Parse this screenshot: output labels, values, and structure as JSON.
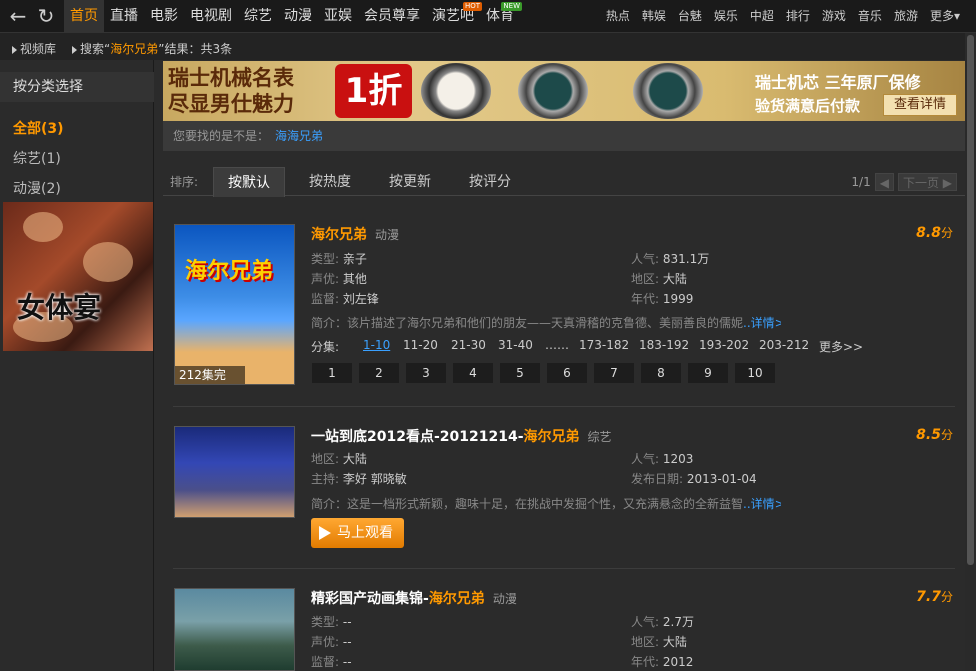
{
  "topbar": {
    "back_icon": "back-arrow-icon",
    "refresh_icon": "refresh-icon",
    "nav": [
      {
        "label": "首页"
      },
      {
        "label": "直播"
      },
      {
        "label": "电影"
      },
      {
        "label": "电视剧"
      },
      {
        "label": "综艺"
      },
      {
        "label": "动漫"
      },
      {
        "label": "亚娱"
      },
      {
        "label": "会员尊享"
      },
      {
        "label": "演艺吧",
        "badge": "HOT"
      },
      {
        "label": "体育",
        "badge": "NEW"
      }
    ],
    "right": [
      "热点",
      "韩娱",
      "台魅",
      "娱乐",
      "中超",
      "排行",
      "游戏",
      "音乐",
      "旅游",
      "更多"
    ]
  },
  "breadcrumb": {
    "lib": "视频库",
    "search_pre": "搜索“",
    "keyword": "海尔兄弟",
    "search_post": "”结果：共3条"
  },
  "sidebar": {
    "title": "按分类选择",
    "filters": [
      "全部(3)",
      "综艺(1)",
      "动漫(2)"
    ],
    "ad_text": "女体宴"
  },
  "banner": {
    "line1": "瑞士机械名表",
    "line2": "尽显男仕魅力",
    "discount": "1折",
    "slogan1": "瑞士机芯 三年原厂保修",
    "slogan2": "验货满意后付款",
    "button": "查看详情"
  },
  "suggest": {
    "label": "您要找的是不是：",
    "link": "海海兄弟"
  },
  "sort": {
    "label": "排序:",
    "tabs": [
      "按默认",
      "按热度",
      "按更新",
      "按评分"
    ],
    "page": "1/1",
    "next": "下一页"
  },
  "results": [
    {
      "title_hl": "海尔兄弟",
      "title_pre": "",
      "title_post": "",
      "cat": "动漫",
      "score_int": "8.8",
      "score_unit": "分",
      "fields": [
        [
          "类型:",
          "亲子"
        ],
        [
          "人气:",
          "831.1万"
        ],
        [
          "声优:",
          "其他"
        ],
        [
          "地区:",
          "大陆"
        ],
        [
          "监督:",
          "刘左锋"
        ],
        [
          "年代:",
          "1999"
        ]
      ],
      "desc_label": "简介：",
      "desc": "该片描述了海尔兄弟和他们的朋友——天真滑稽的克鲁德、美丽善良的儒妮",
      "more": "..详情>>",
      "eps_label": "分集:",
      "ep_ranges": [
        "1-10",
        "11-20",
        "21-30",
        "31-40",
        "……",
        "173-182",
        "183-192",
        "193-202",
        "203-212",
        "更多>>"
      ],
      "ep_buttons": [
        "1",
        "2",
        "3",
        "4",
        "5",
        "6",
        "7",
        "8",
        "9",
        "10"
      ],
      "poster_text": "海尔兄弟",
      "poster_eps": "212集完"
    },
    {
      "title_pre": "一站到底2012看点-20121214-",
      "title_hl": "海尔兄弟",
      "title_post": "",
      "cat": "综艺",
      "score_int": "8.5",
      "score_unit": "分",
      "fields": [
        [
          "地区:",
          "大陆"
        ],
        [
          "人气:",
          "1203"
        ],
        [
          "主持:",
          "李好  郭晓敏"
        ],
        [
          "发布日期:",
          "2013-01-04"
        ]
      ],
      "desc_label": "简介：",
      "desc": "这是一档形式新颖，趣味十足，在挑战中发掘个性，又充满悬念的全新益智",
      "more": "..详情>>",
      "watch": "马上观看"
    },
    {
      "title_pre": "精彩国产动画集锦-",
      "title_hl": "海尔兄弟",
      "title_post": "",
      "cat": "动漫",
      "score_int": "7.7",
      "score_unit": "分",
      "fields": [
        [
          "类型:",
          "--"
        ],
        [
          "人气:",
          "2.7万"
        ],
        [
          "声优:",
          "--"
        ],
        [
          "地区:",
          "大陆"
        ],
        [
          "监督:",
          "--"
        ],
        [
          "年代:",
          "2012"
        ]
      ]
    }
  ]
}
